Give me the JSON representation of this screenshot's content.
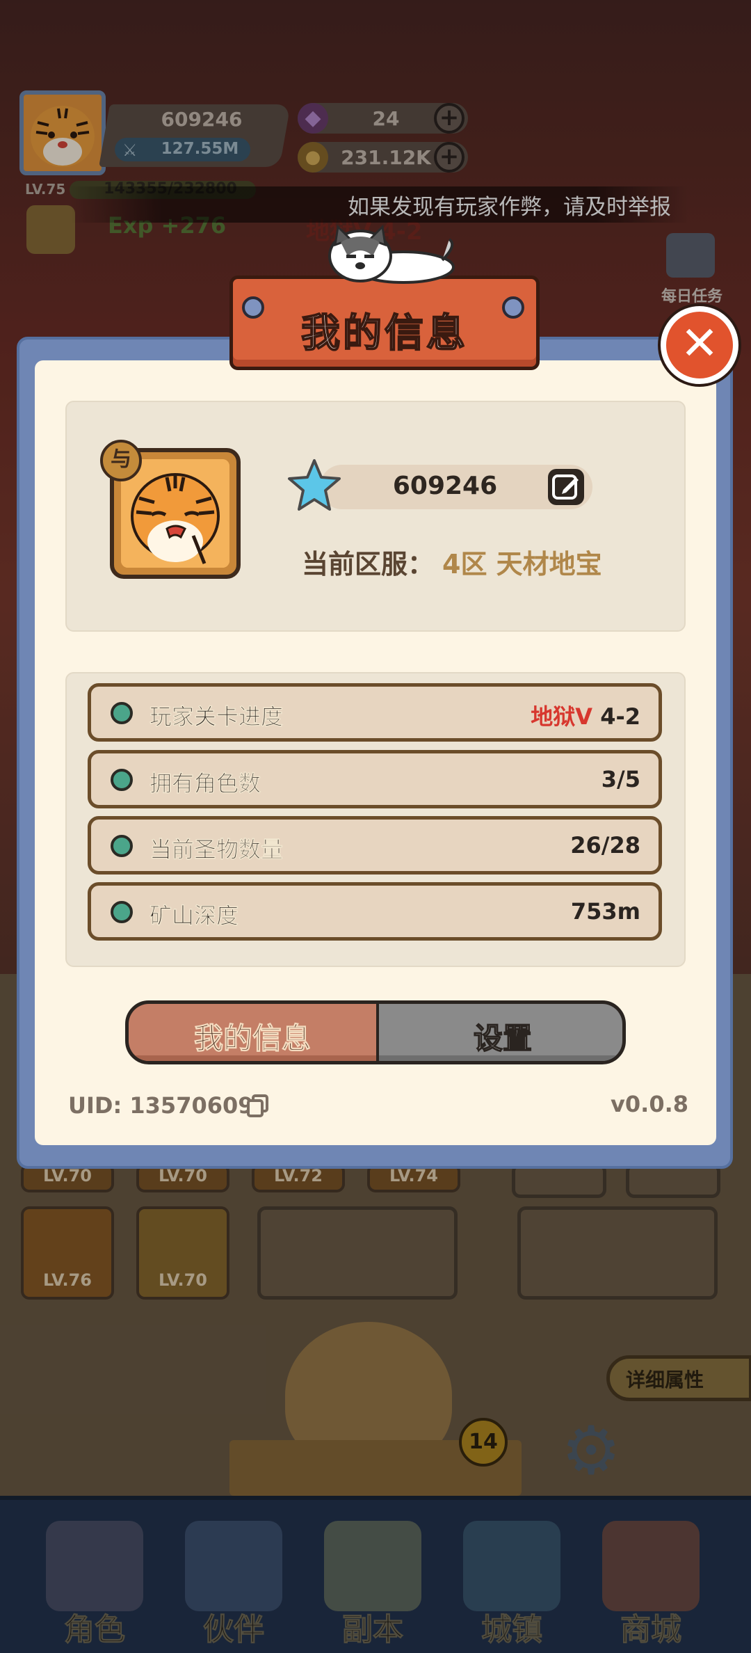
{
  "hud": {
    "player_name": "609246",
    "power": "127.55M",
    "gems": "24",
    "gold": "231.12K",
    "plus": "+",
    "level": "LV.75",
    "exp": "143355/232800",
    "exp_gain": "Exp +276",
    "stage": "地狱V 4-2",
    "daily_tasks_label": "每日任务"
  },
  "report_banner": "如果发现有玩家作弊，请及时举报",
  "background_slots": {
    "row1": [
      "LV.70",
      "LV.70",
      "LV.72",
      "LV.74"
    ],
    "row2": [
      "LV.76",
      "LV.70"
    ],
    "detail_button": "详细属性",
    "badge_count": "14"
  },
  "bottom_nav": [
    {
      "label": "角色"
    },
    {
      "label": "伙伴"
    },
    {
      "label": "副本"
    },
    {
      "label": "城镇"
    },
    {
      "label": "商城"
    }
  ],
  "modal": {
    "title": "我的信息",
    "close_symbol": "✕",
    "profile": {
      "swap_badge": "与",
      "name": "609246",
      "server_label": "当前区服：",
      "server_value": "4区 天材地宝"
    },
    "stats": [
      {
        "label": "玩家关卡进度",
        "value_prefix": "地狱V",
        "value": "4-2"
      },
      {
        "label": "拥有角色数",
        "value_prefix": "",
        "value": "3/5"
      },
      {
        "label": "当前圣物数量",
        "value_prefix": "",
        "value": "26/28"
      },
      {
        "label": "矿山深度",
        "value_prefix": "",
        "value": "753m"
      }
    ],
    "tabs": {
      "mine": "我的信息",
      "settings": "设置"
    },
    "uid": "UID: 13570609",
    "version": "v0.0.8"
  },
  "colors": {
    "accent_orange": "#d9623c",
    "modal_blue": "#6f86b4",
    "stat_dot_green": "#4ba58a",
    "hell_red": "#d7372e"
  }
}
